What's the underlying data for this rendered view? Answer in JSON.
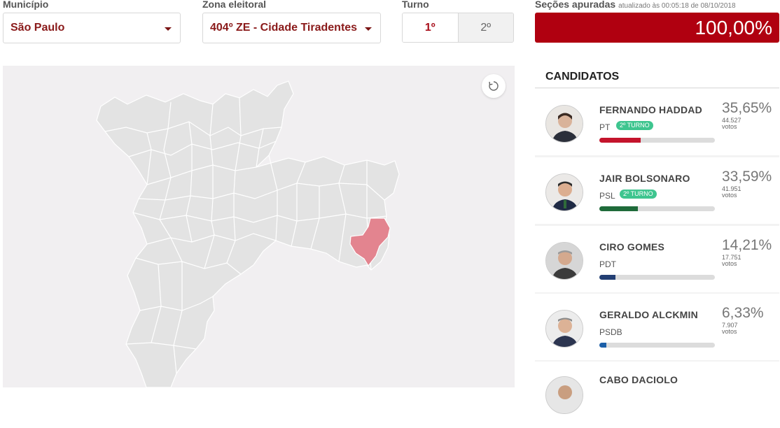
{
  "filters": {
    "municipio": {
      "label": "Município",
      "value": "São Paulo"
    },
    "zona": {
      "label": "Zona eleitoral",
      "value": "404º ZE - Cidade Tiradentes"
    },
    "turno": {
      "label": "Turno",
      "options": [
        "1º",
        "2º"
      ],
      "selected": "1º"
    }
  },
  "secoes": {
    "label": "Seções apuradas",
    "updated": "atualizado às 00:05:18 de 08/10/2018",
    "value": "100,00%",
    "fraction": 1.0
  },
  "colors": {
    "accent": "#b00010",
    "map_base": "#e3e3e3",
    "map_highlight": "#e3848f",
    "badge": "#3ec58f"
  },
  "map": {
    "reset_icon": "refresh-icon"
  },
  "panel": {
    "title": "CANDIDATOS",
    "candidates": [
      {
        "name": "FERNANDO HADDAD",
        "party": "PT",
        "badge": "2º TURNO",
        "percent": "35,65%",
        "votes": "44.527",
        "votes_label": "votos",
        "share": 0.3565,
        "color": "#c4142c"
      },
      {
        "name": "JAIR BOLSONARO",
        "party": "PSL",
        "badge": "2º TURNO",
        "percent": "33,59%",
        "votes": "41.951",
        "votes_label": "votos",
        "share": 0.3359,
        "color": "#1f6b3a"
      },
      {
        "name": "CIRO GOMES",
        "party": "PDT",
        "badge": "",
        "percent": "14,21%",
        "votes": "17.751",
        "votes_label": "votos",
        "share": 0.1421,
        "color": "#233f73"
      },
      {
        "name": "GERALDO ALCKMIN",
        "party": "PSDB",
        "badge": "",
        "percent": "6,33%",
        "votes": "7.907",
        "votes_label": "votos",
        "share": 0.0633,
        "color": "#1c5fa8"
      },
      {
        "name": "CABO DACIOLO",
        "party": "",
        "badge": "",
        "percent": "",
        "votes": "",
        "votes_label": "",
        "share": 0,
        "color": "#1f6b3a"
      }
    ]
  }
}
